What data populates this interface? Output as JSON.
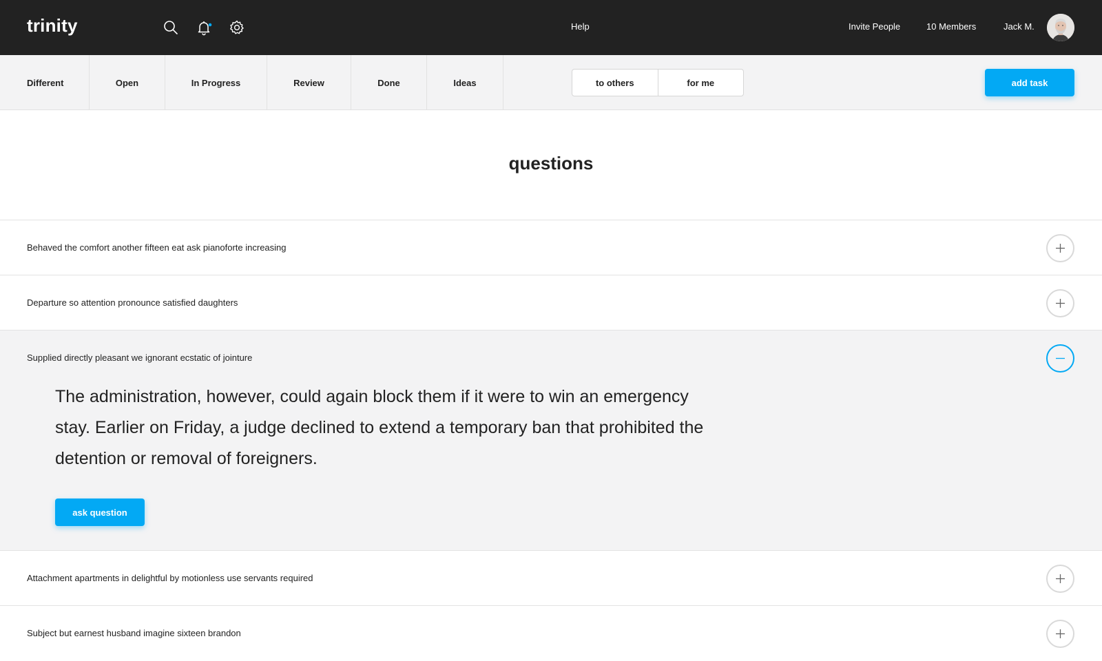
{
  "header": {
    "logo": "trinity",
    "icons": [
      "search-icon",
      "bell-icon",
      "gear-icon"
    ],
    "help_label": "Help",
    "invite_label": "Invite People",
    "members_label": "10 Members",
    "user_name": "Jack M."
  },
  "subnav": {
    "status_tabs": [
      {
        "label": "Different"
      },
      {
        "label": "Open"
      },
      {
        "label": "In Progress"
      },
      {
        "label": "Review"
      },
      {
        "label": "Done"
      },
      {
        "label": "Ideas"
      }
    ],
    "segments": [
      {
        "label": "to others"
      },
      {
        "label": "for me"
      }
    ],
    "add_task_label": "add task"
  },
  "main": {
    "title": "questions",
    "questions": [
      {
        "text": "Behaved the comfort another fifteen eat ask pianoforte increasing",
        "expanded": false
      },
      {
        "text": "Departure so attention pronounce satisfied daughters",
        "expanded": false
      },
      {
        "text": "Supplied directly pleasant we ignorant ecstatic of jointure",
        "expanded": true,
        "answer": "The administration, however, could again block them if it were to win an emergency stay. Earlier on Friday, a judge declined to extend a temporary ban that prohibited the detention or removal of foreigners.",
        "ask_label": "ask question"
      },
      {
        "text": "Attachment apartments in delightful by motionless use servants required",
        "expanded": false
      },
      {
        "text": "Subject but earnest husband imagine sixteen brandon",
        "expanded": false
      }
    ]
  },
  "colors": {
    "topbar": "#222222",
    "accent": "#03a9f4",
    "subnav_bg": "#f3f3f4",
    "notification_dot": "#03a9f4"
  }
}
